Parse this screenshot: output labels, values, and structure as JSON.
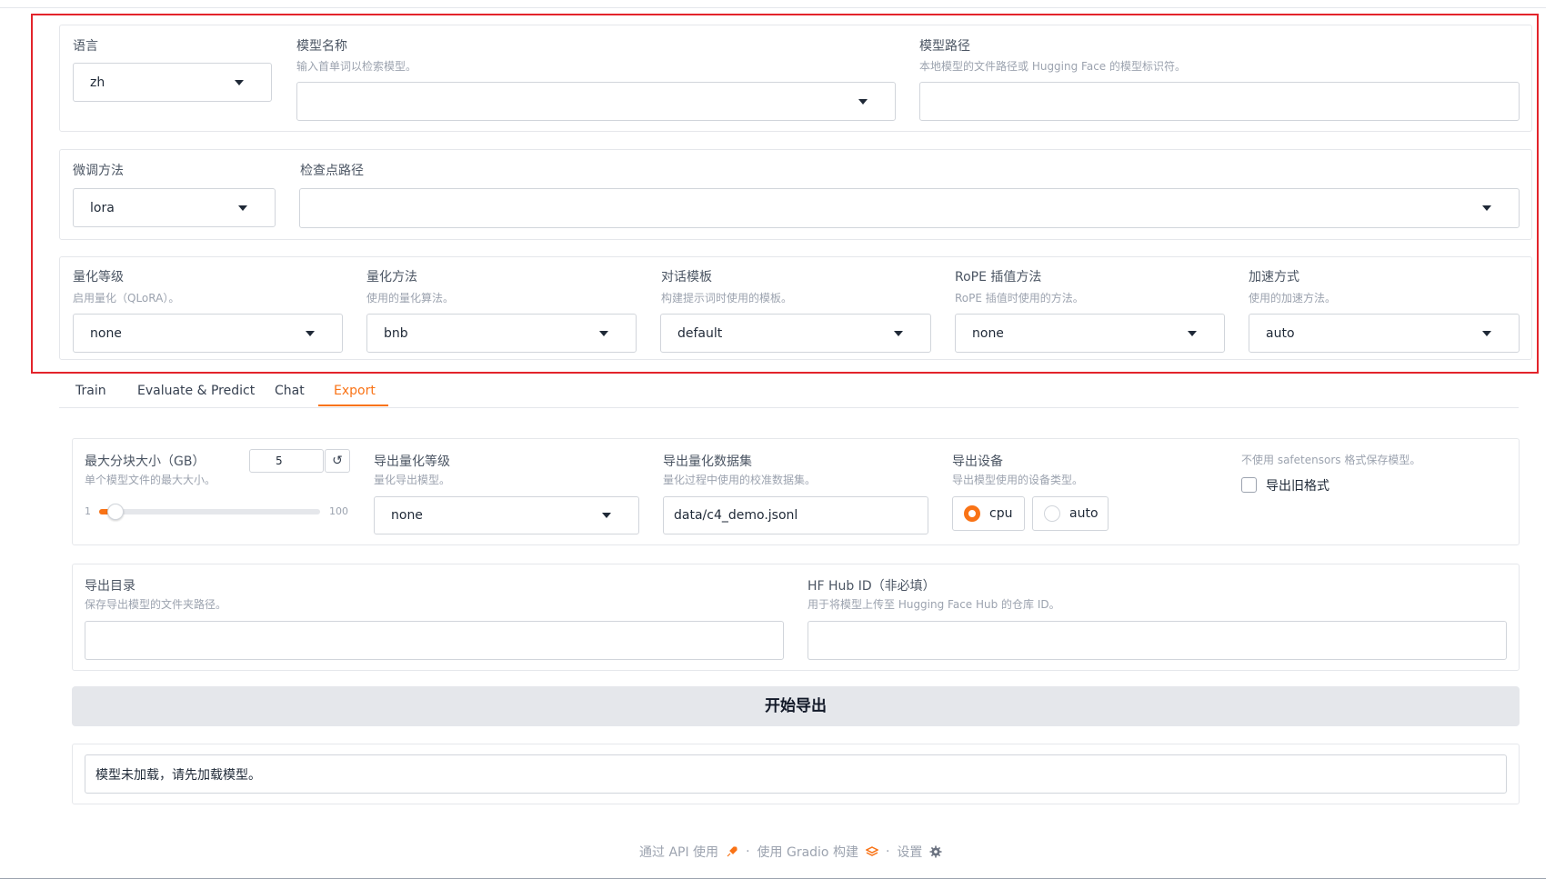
{
  "top": {
    "language": {
      "label": "语言",
      "value": "zh"
    },
    "model_name": {
      "label": "模型名称",
      "info": "输入首单词以检索模型。",
      "value": ""
    },
    "model_path": {
      "label": "模型路径",
      "info": "本地模型的文件路径或 Hugging Face 的模型标识符。",
      "value": ""
    },
    "finetuning_type": {
      "label": "微调方法",
      "value": "lora"
    },
    "checkpoint_path": {
      "label": "检查点路径",
      "value": ""
    },
    "quantization_bit": {
      "label": "量化等级",
      "info": "启用量化（QLoRA）。",
      "value": "none"
    },
    "quantization_method": {
      "label": "量化方法",
      "info": "使用的量化算法。",
      "value": "bnb"
    },
    "template": {
      "label": "对话模板",
      "info": "构建提示词时使用的模板。",
      "value": "default"
    },
    "rope_scaling": {
      "label": "RoPE 插值方法",
      "info": "RoPE 插值时使用的方法。",
      "value": "none"
    },
    "booster": {
      "label": "加速方式",
      "info": "使用的加速方法。",
      "value": "auto"
    }
  },
  "tabs": [
    {
      "label": "Train"
    },
    {
      "label": "Evaluate & Predict"
    },
    {
      "label": "Chat"
    },
    {
      "label": "Export",
      "active": true
    }
  ],
  "export": {
    "max_shard_size": {
      "label": "最大分块大小（GB）",
      "info": "单个模型文件的最大大小。",
      "value": "5",
      "min": "1",
      "max": "100",
      "reset": "↺"
    },
    "export_quantization_bit": {
      "label": "导出量化等级",
      "info": "量化导出模型。",
      "value": "none"
    },
    "export_quantization_dataset": {
      "label": "导出量化数据集",
      "info": "量化过程中使用的校准数据集。",
      "value": "data/c4_demo.jsonl"
    },
    "export_device": {
      "label": "导出设备",
      "info": "导出模型使用的设备类型。",
      "options": [
        "cpu",
        "auto"
      ],
      "selected": "cpu"
    },
    "export_legacy_format": {
      "info": "不使用 safetensors 格式保存模型。",
      "label": "导出旧格式",
      "checked": false
    },
    "export_dir": {
      "label": "导出目录",
      "info": "保存导出模型的文件夹路径。",
      "value": ""
    },
    "export_hub_model_id": {
      "label": "HF Hub ID（非必填）",
      "info": "用于将模型上传至 Hugging Face Hub 的仓库 ID。",
      "value": ""
    },
    "export_button": "开始导出",
    "info_box": "模型未加载，请先加载模型。"
  },
  "footer": {
    "api": "通过 API 使用",
    "sep": "·",
    "built": "使用 Gradio 构建",
    "settings": "设置"
  },
  "colors": {
    "accent": "#f97316",
    "highlight_frame": "#e3242b"
  }
}
